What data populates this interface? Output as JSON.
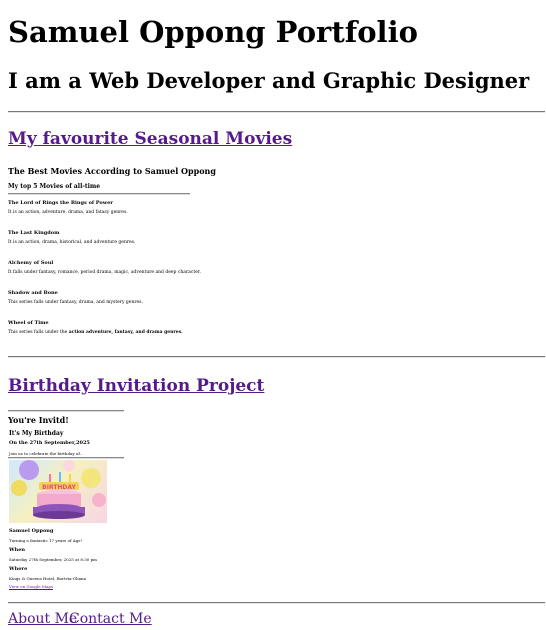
{
  "header": {
    "title": "Samuel Oppong Portfolio",
    "subtitle": "I am a Web Developer and Graphic Designer"
  },
  "movies_section": {
    "link": "My favourite Seasonal Movies",
    "heading": "The Best Movies According to Samuel Oppong",
    "subheading": "My top 5 Movies of all-time",
    "items": [
      {
        "title": "The Lord of Rings the Rings of Power",
        "desc": "It is an action, adventure, drama, and fatasy genres."
      },
      {
        "title": "The Last Kingdom",
        "desc": "It is an action, drama, historical, and adventure genres."
      },
      {
        "title": "Alchemy of Soul",
        "desc": "It falls under fantasy, romance, period drama, magic, adventure and deep character."
      },
      {
        "title": "Shadow and Bone",
        "desc": "This series falls under fantasy, drama, and mystery genres."
      },
      {
        "title": "Wheel of Time",
        "desc_prefix": "This series falls under the ",
        "desc_bold": "action adventure, fantasy, and drama genres."
      }
    ]
  },
  "birthday_section": {
    "link": "Birthday Invitation Project",
    "invite_title": "You're Invitd!",
    "my_birthday": "It's My Birthday",
    "date_line": "On the 27th September,2025",
    "join_line": "Join us to celebrate the birthday of..",
    "cake_text": "BIRTHDAY",
    "name": "Samuel Oppong",
    "turning": "Turning a fantastic 17 years of Age!",
    "when_label": "When",
    "when_value": "Saturday 27th September, 2025 at 8:30 pm",
    "where_label": "Where",
    "where_value": "Kings & Queens Hotel, Bortvia-Ghana",
    "map_link": "View on Google Maps"
  },
  "footer": {
    "about": "About Me",
    "contact": "Contact Me"
  },
  "colors": {
    "link": "#551a8b"
  }
}
